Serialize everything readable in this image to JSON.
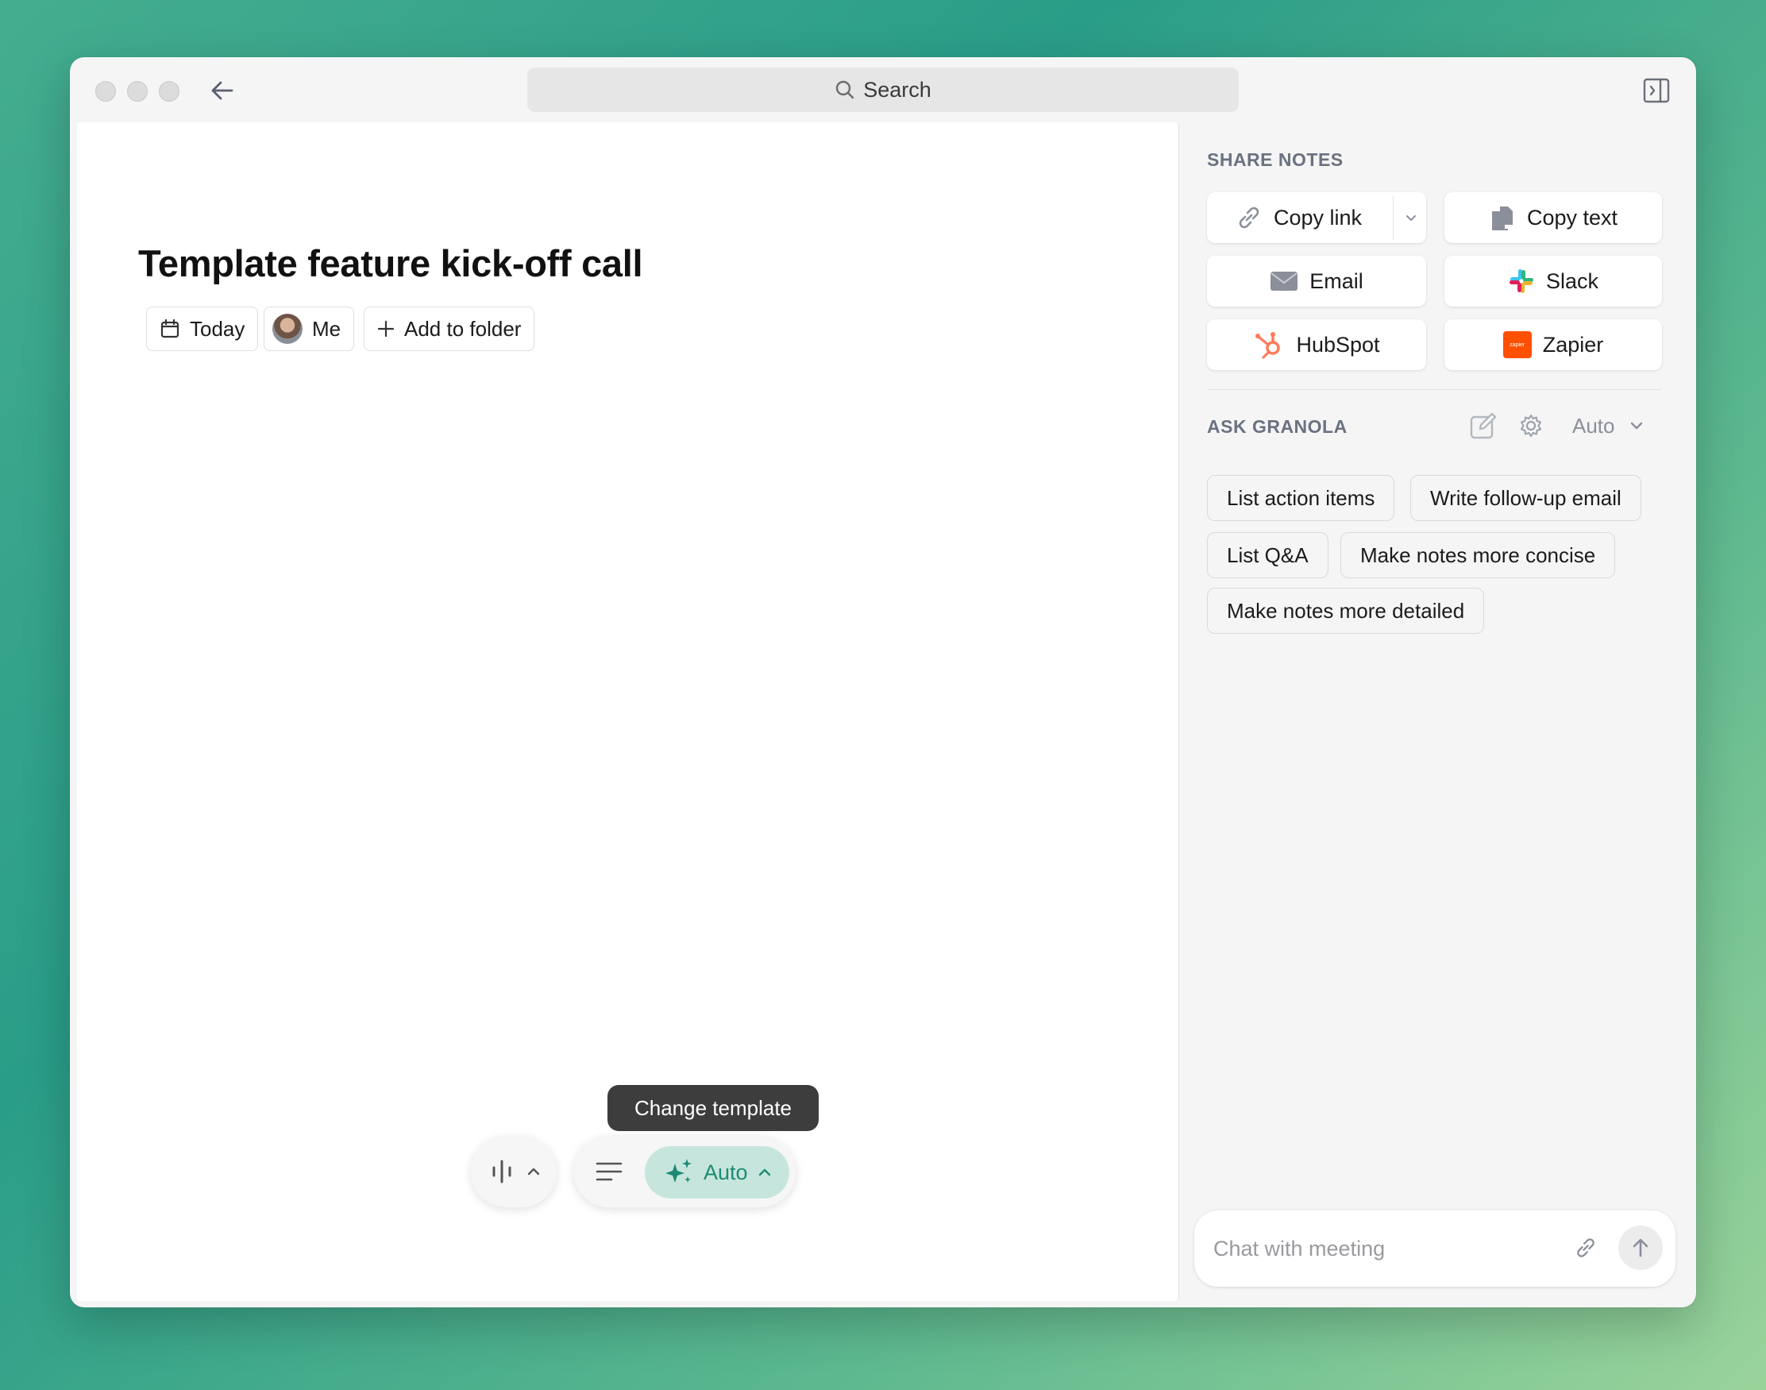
{
  "titlebar": {
    "search_label": "Search"
  },
  "note": {
    "title": "Template feature kick-off call",
    "chips": {
      "date": "Today",
      "person": "Me",
      "folder": "Add to folder"
    }
  },
  "toolbar": {
    "tooltip": "Change template",
    "template_mode": "Auto"
  },
  "share": {
    "heading": "SHARE NOTES",
    "buttons": {
      "copy_link": "Copy link",
      "copy_text": "Copy text",
      "email": "Email",
      "slack": "Slack",
      "hubspot": "HubSpot",
      "zapier": "Zapier"
    },
    "zapier_badge": "zapier"
  },
  "ask": {
    "heading": "ASK GRANOLA",
    "mode": "Auto",
    "suggestions": [
      "List action items",
      "Write follow-up email",
      "List Q&A",
      "Make notes more concise",
      "Make notes more detailed"
    ]
  },
  "chat": {
    "placeholder": "Chat with meeting"
  },
  "colors": {
    "accent": "#1f8a73",
    "accent_bg": "#c6e6dd",
    "hubspot": "#ff7a59",
    "zapier": "#ff4f00"
  }
}
